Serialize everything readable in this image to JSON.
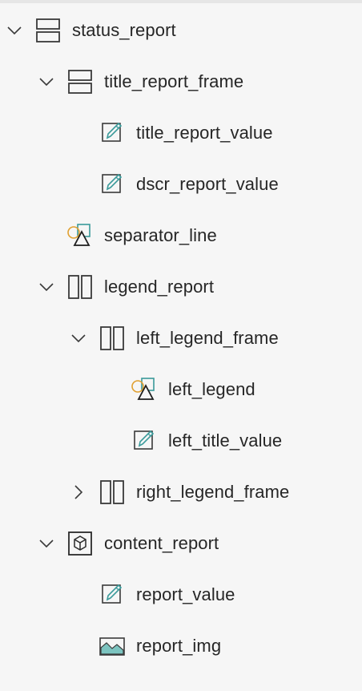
{
  "tree": {
    "items": [
      {
        "label": "status_report",
        "icon": "horizontal-stack-icon",
        "expanded": true
      },
      {
        "label": "title_report_frame",
        "icon": "horizontal-stack-icon",
        "expanded": true
      },
      {
        "label": "title_report_value",
        "icon": "text-edit-icon"
      },
      {
        "label": "dscr_report_value",
        "icon": "text-edit-icon"
      },
      {
        "label": "separator_line",
        "icon": "shapes-icon"
      },
      {
        "label": "legend_report",
        "icon": "vertical-stack-icon",
        "expanded": true
      },
      {
        "label": "left_legend_frame",
        "icon": "vertical-stack-icon",
        "expanded": true
      },
      {
        "label": "left_legend",
        "icon": "shapes-icon"
      },
      {
        "label": "left_title_value",
        "icon": "text-edit-icon"
      },
      {
        "label": "right_legend_frame",
        "icon": "vertical-stack-icon",
        "expanded": false
      },
      {
        "label": "content_report",
        "icon": "component-box-icon",
        "expanded": true
      },
      {
        "label": "report_value",
        "icon": "text-edit-icon"
      },
      {
        "label": "report_img",
        "icon": "image-icon"
      }
    ]
  },
  "colors": {
    "background": "#f6f6f6",
    "text": "#262626",
    "icon_stroke": "#3a3a3a",
    "accent_teal": "#3a9a9a",
    "accent_orange": "#e0a030"
  }
}
